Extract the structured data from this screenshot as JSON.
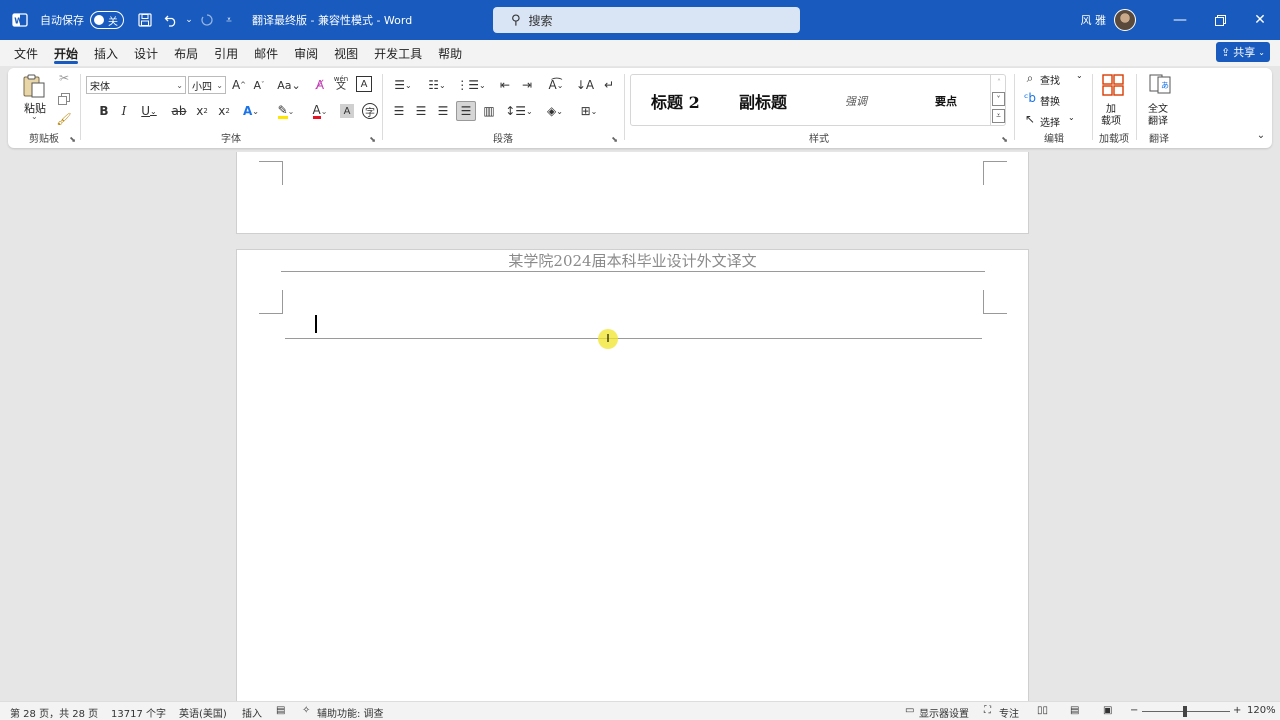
{
  "titlebar": {
    "autosave_label": "自动保存",
    "toggle_state": "关",
    "doc_title": "翻译最终版 - 兼容性模式 - Word",
    "search_placeholder": "搜索",
    "user_name": "风 雅"
  },
  "menu": {
    "items": [
      "文件",
      "开始",
      "插入",
      "设计",
      "布局",
      "引用",
      "邮件",
      "审阅",
      "视图",
      "开发工具",
      "帮助"
    ],
    "active": "开始",
    "share_label": "共享"
  },
  "ribbon": {
    "clipboard": {
      "paste_label": "粘贴",
      "group_label": "剪贴板"
    },
    "font": {
      "font_name": "宋体",
      "font_size": "小四",
      "group_label": "字体",
      "wen_label": "wén"
    },
    "paragraph": {
      "group_label": "段落"
    },
    "styles": {
      "items": [
        "标题 2",
        "副标题",
        "强调",
        "要点"
      ],
      "group_label": "样式"
    },
    "editing": {
      "find_label": "查找",
      "replace_label": "替换",
      "select_label": "选择",
      "group_label": "编辑"
    },
    "addins": {
      "button_label_1": "加",
      "button_label_2": "载项",
      "group_label": "加载项"
    },
    "translate": {
      "button_label_1": "全文",
      "button_label_2": "翻译",
      "group_label": "翻译"
    }
  },
  "document": {
    "header_text": "某学院2024届本科毕业设计外文译文"
  },
  "status": {
    "page_info": "第 28 页，共 28 页",
    "word_count": "13717 个字",
    "language": "英语(美国)",
    "insert_mode": "插入",
    "accessibility": "辅助功能: 调查",
    "display_settings": "显示器设置",
    "focus": "专注",
    "zoom": "120%"
  },
  "colors": {
    "brand": "#185abd",
    "highlight": "#ffe600",
    "font_color": "#e81123"
  }
}
